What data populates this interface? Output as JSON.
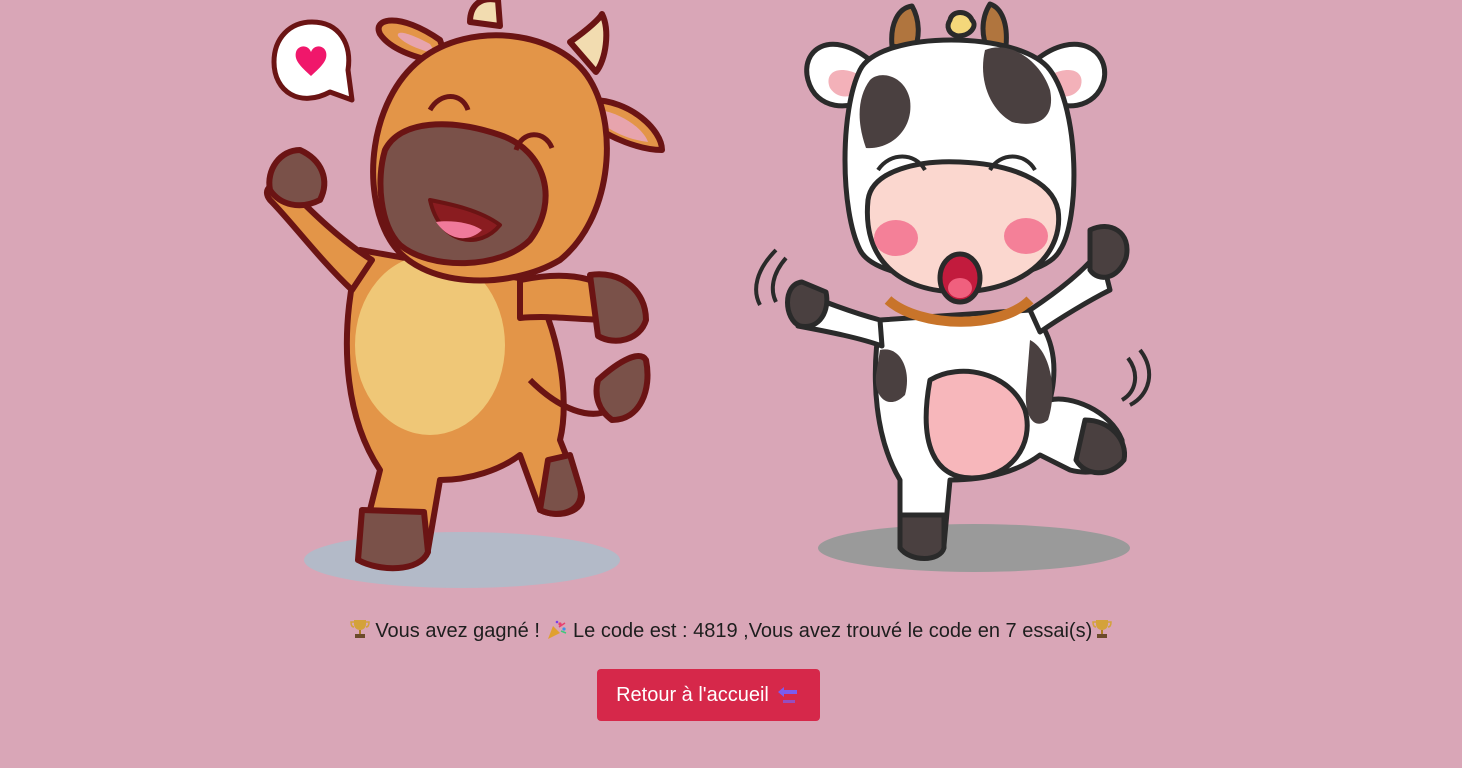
{
  "result": {
    "win_text": "Vous avez gagné !",
    "code_text": "Le code est : 4819 ,Vous avez trouvé le code en 7 essai(s)",
    "leading_icon": "trophy-icon",
    "middle_icon": "party-popper-icon",
    "trailing_icon": "trophy-icon"
  },
  "actions": {
    "home_button_label": "Retour à l'accueil",
    "home_button_icon": "back-arrow-icon",
    "home_button_color": "#d6284a"
  },
  "illustration": {
    "description_icons": [
      "heart-icon"
    ],
    "background_color": "#d9a6b7"
  }
}
